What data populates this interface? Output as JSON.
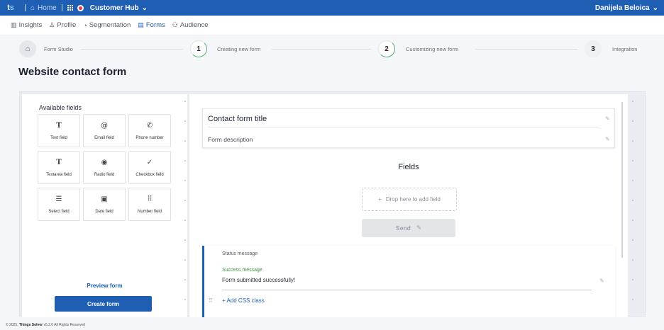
{
  "topbar": {
    "logo": "ts",
    "home": "Home",
    "app": "Customer Hub",
    "user": "Danijela Beloica"
  },
  "nav": {
    "items": [
      {
        "label": "Insights",
        "icon": "bar-chart-icon"
      },
      {
        "label": "Profile",
        "icon": "person-icon"
      },
      {
        "label": "Segmentation",
        "icon": "pie-icon"
      },
      {
        "label": "Forms",
        "icon": "clipboard-icon",
        "active": true
      },
      {
        "label": "Audience",
        "icon": "people-icon"
      }
    ]
  },
  "stepper": {
    "home_label": "Form Studio",
    "steps": [
      {
        "number": "1",
        "label": "Creating new form"
      },
      {
        "number": "2",
        "label": "Customizing new form"
      },
      {
        "number": "3",
        "label": "Integration"
      }
    ]
  },
  "page_title": "Website contact form",
  "available_fields": {
    "title": "Available fields",
    "items": [
      {
        "label": "Text field",
        "icon": "T"
      },
      {
        "label": "Email field",
        "icon": "@"
      },
      {
        "label": "Phone number",
        "icon": "✆"
      },
      {
        "label": "Textarea field",
        "icon": "T"
      },
      {
        "label": "Radio field",
        "icon": "◉"
      },
      {
        "label": "Checkbox field",
        "icon": "✓"
      },
      {
        "label": "Select field",
        "icon": "☰"
      },
      {
        "label": "Date field",
        "icon": "▣"
      },
      {
        "label": "Number field",
        "icon": "⠿"
      }
    ],
    "preview": "Preview form",
    "create": "Create form"
  },
  "canvas": {
    "form_title": "Contact form title",
    "form_description": "Form description",
    "fields_heading": "Fields",
    "drop_text": "Drop here to add field",
    "send_label": "Send",
    "status_label": "Status message",
    "success_label": "Success message",
    "success_text": "Form submitted successfully!",
    "add_css": "+ Add CSS class"
  },
  "footer": {
    "prefix": "© 2025.",
    "brand": "Things Solver",
    "suffix": "v5.2.0 All Rights Reserved"
  },
  "colors": {
    "primary": "#1e5fb3",
    "success": "#3a9a3a",
    "progress": "#4cae6e"
  }
}
